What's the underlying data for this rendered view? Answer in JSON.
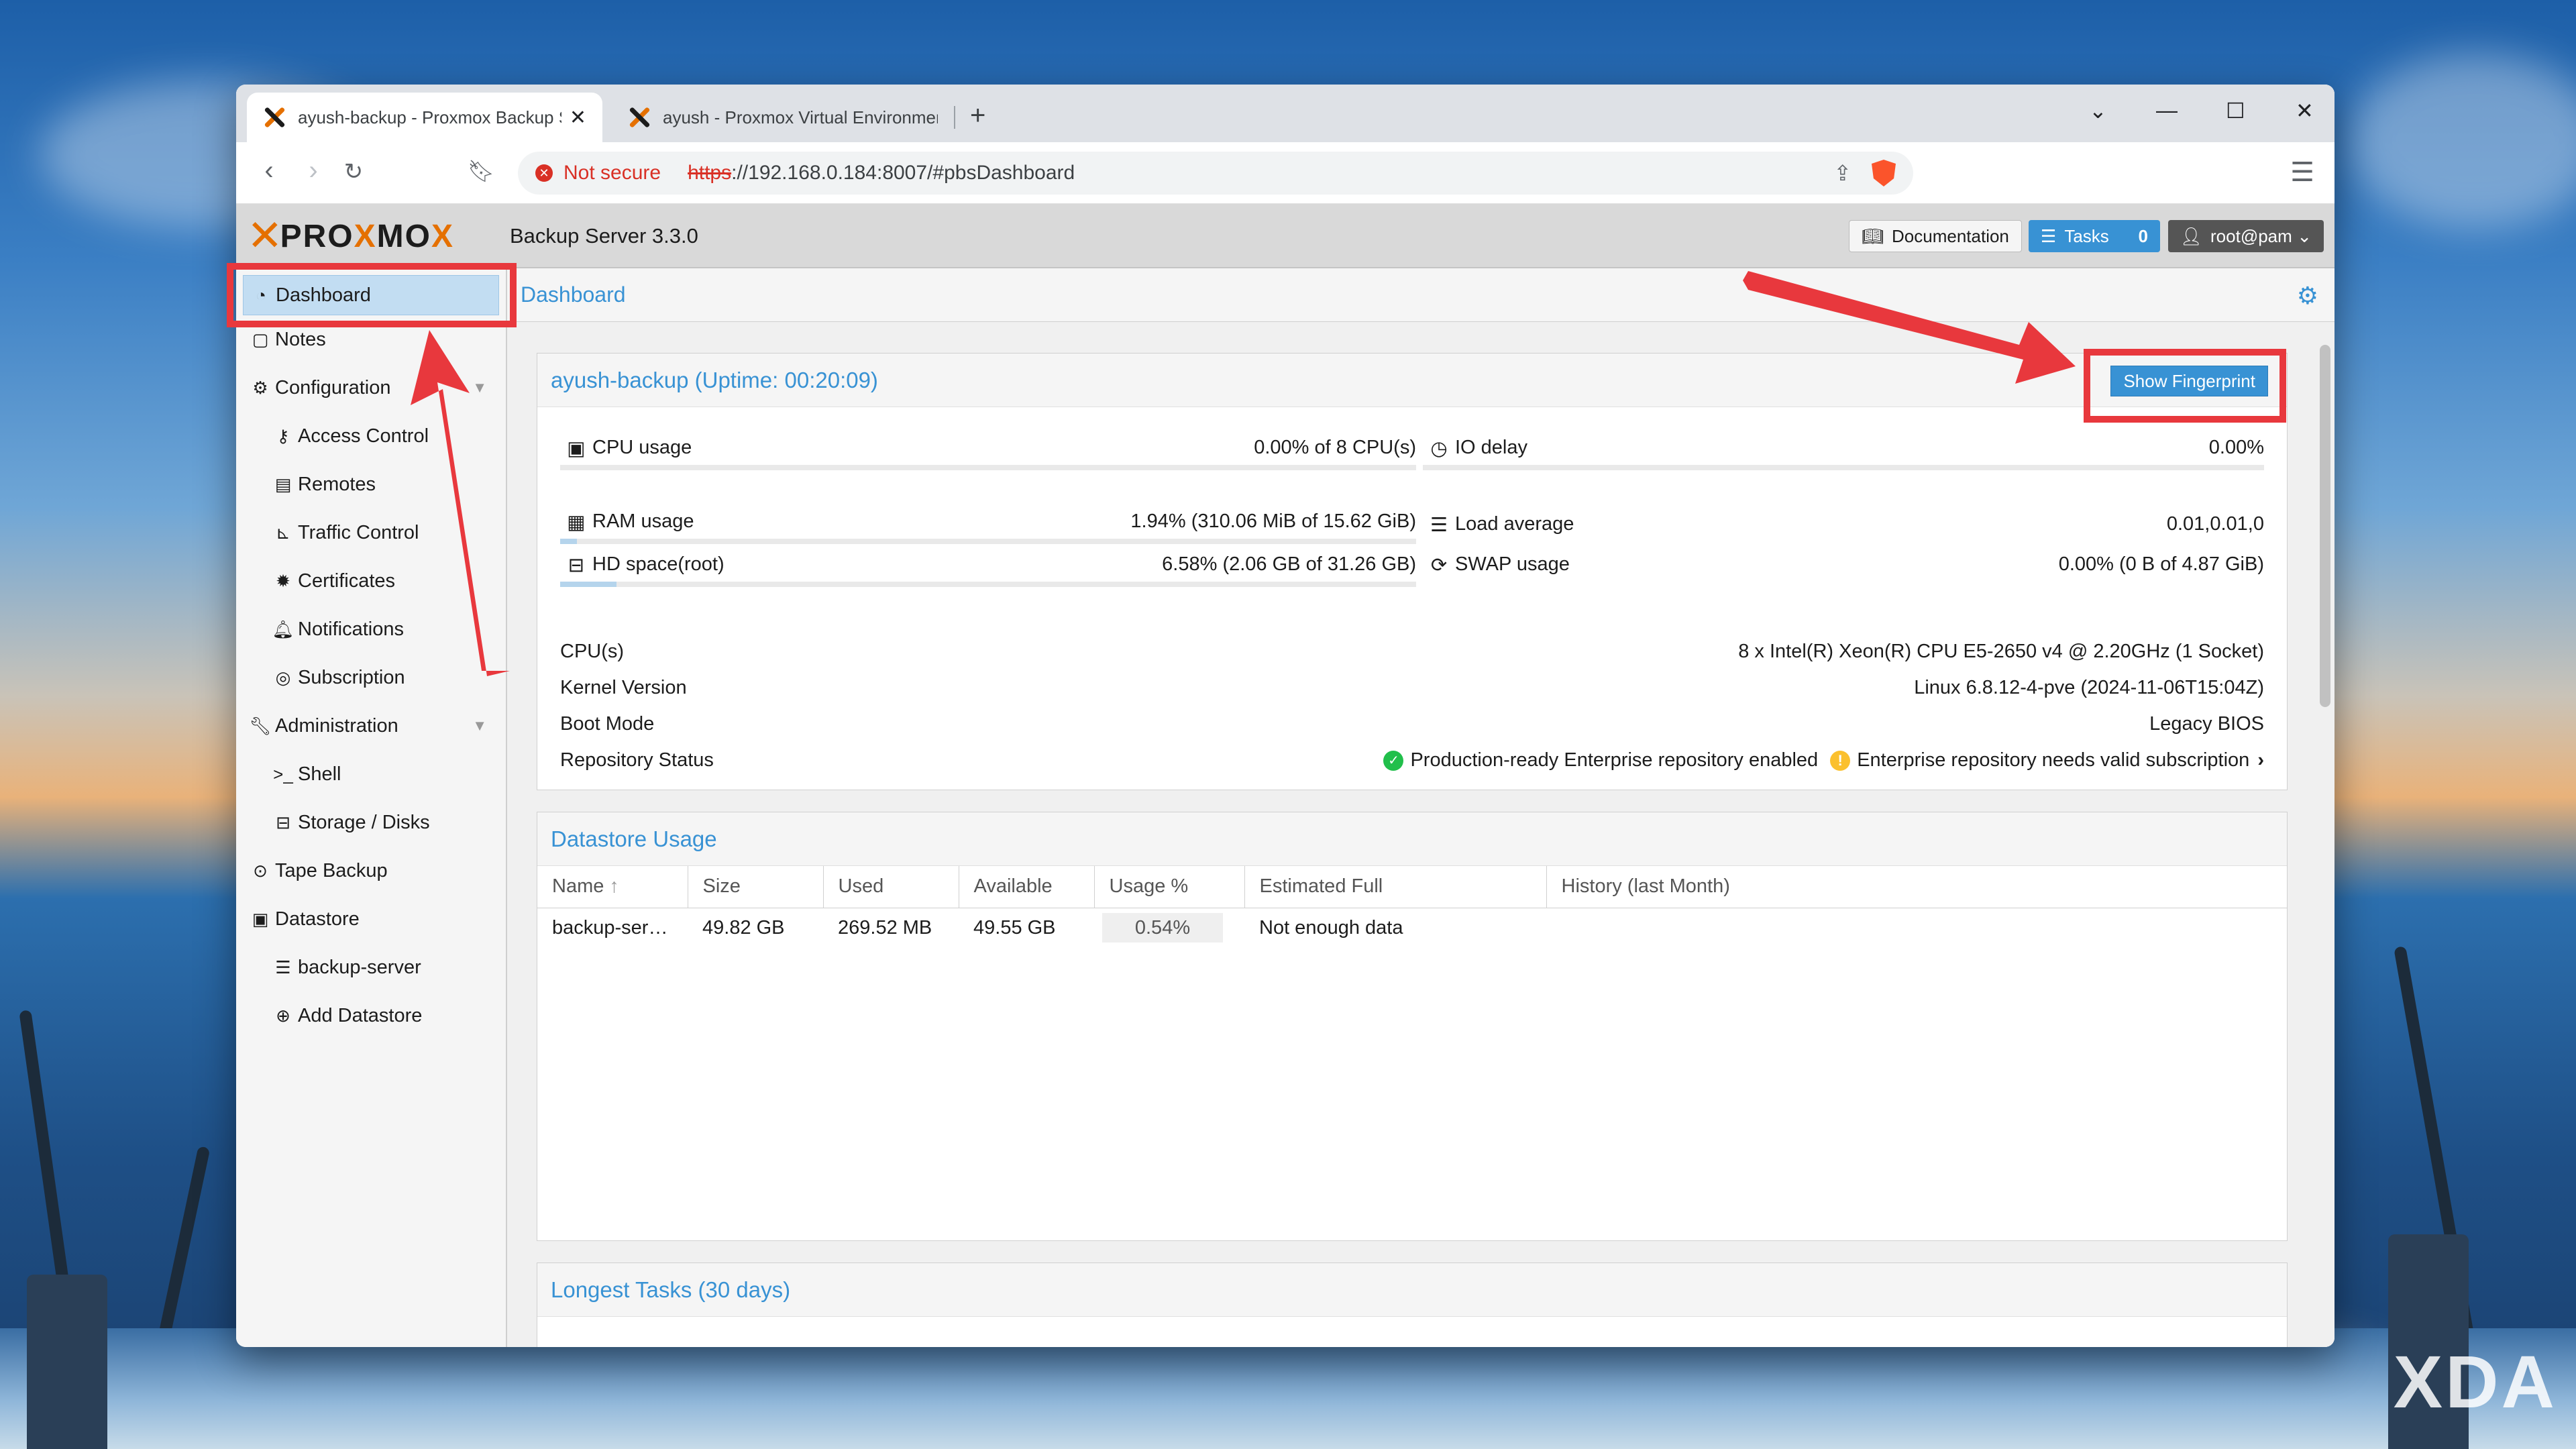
{
  "browser": {
    "tabs": [
      {
        "title": "ayush-backup - Proxmox Backup Server"
      },
      {
        "title": "ayush - Proxmox Virtual Environment"
      }
    ],
    "url_warning": "Not secure",
    "url_scheme": "https",
    "url_rest": "://192.168.0.184:8007/#pbsDashboard"
  },
  "header": {
    "product": "Backup Server 3.3.0",
    "documentation": "Documentation",
    "tasks_label": "Tasks",
    "tasks_count": "0",
    "user": "root@pam"
  },
  "sidebar": {
    "items": [
      {
        "label": "Dashboard"
      },
      {
        "label": "Notes"
      },
      {
        "label": "Configuration"
      },
      {
        "label": "Access Control"
      },
      {
        "label": "Remotes"
      },
      {
        "label": "Traffic Control"
      },
      {
        "label": "Certificates"
      },
      {
        "label": "Notifications"
      },
      {
        "label": "Subscription"
      },
      {
        "label": "Administration"
      },
      {
        "label": "Shell"
      },
      {
        "label": "Storage / Disks"
      },
      {
        "label": "Tape Backup"
      },
      {
        "label": "Datastore"
      },
      {
        "label": "backup-server"
      },
      {
        "label": "Add Datastore"
      }
    ]
  },
  "main": {
    "title": "Dashboard",
    "node_panel": {
      "title": "ayush-backup (Uptime: 00:20:09)",
      "fingerprint_button": "Show Fingerprint",
      "cpu": {
        "label": "CPU usage",
        "value": "0.00% of 8 CPU(s)",
        "fraction": 0.0
      },
      "io": {
        "label": "IO delay",
        "value": "0.00%",
        "fraction": 0.0
      },
      "ram": {
        "label": "RAM usage",
        "value": "1.94% (310.06 MiB of 15.62 GiB)",
        "fraction": 0.0194
      },
      "load": {
        "label": "Load average",
        "value": "0.01,0.01,0"
      },
      "hd": {
        "label": "HD space(root)",
        "value": "6.58% (2.06 GB of 31.26 GB)",
        "fraction": 0.0658
      },
      "swap": {
        "label": "SWAP usage",
        "value": "0.00% (0 B of 4.87 GiB)",
        "fraction": 0.0
      },
      "info": {
        "cpus_label": "CPU(s)",
        "cpus_value": "8 x Intel(R) Xeon(R) CPU E5-2650 v4 @ 2.20GHz (1 Socket)",
        "kernel_label": "Kernel Version",
        "kernel_value": "Linux 6.8.12-4-pve (2024-11-06T15:04Z)",
        "boot_label": "Boot Mode",
        "boot_value": "Legacy BIOS",
        "repo_label": "Repository Status",
        "repo_ok": "Production-ready Enterprise repository enabled",
        "repo_warn": "Enterprise repository needs valid subscription"
      }
    },
    "datastore_panel": {
      "title": "Datastore Usage",
      "columns": [
        "Name",
        "Size",
        "Used",
        "Available",
        "Usage %",
        "Estimated Full",
        "History (last Month)"
      ],
      "rows": [
        {
          "name": "backup-ser…",
          "size": "49.82 GB",
          "used": "269.52 MB",
          "available": "49.55 GB",
          "usage": "0.54%",
          "estimated": "Not enough data"
        }
      ]
    },
    "tasks_panel": {
      "title": "Longest Tasks (30 days)"
    }
  },
  "watermark": "XDA",
  "colors": {
    "accent": "#3892d4",
    "brand_orange": "#e57000",
    "annotation_red": "#e8383d"
  }
}
